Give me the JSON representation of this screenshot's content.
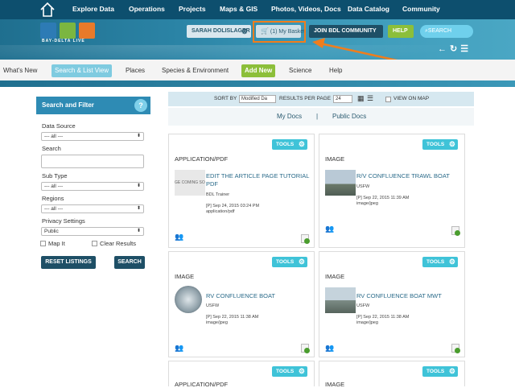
{
  "topnav": {
    "items": [
      "Explore Data",
      "Operations",
      "Projects",
      "Maps & GIS",
      "Photos, Videos, Docs",
      "Data Catalog",
      "Community"
    ]
  },
  "header": {
    "logo_text": "BAY-DELTA LIVE",
    "user_name": "SARAH DOLISLAGER",
    "basket_label": "(1) My Basket",
    "join_label": "JOIN BDL COMMUNITY",
    "help_label": "HELP",
    "search_placeholder": "SEARCH",
    "highlight_color": "#f07d1c"
  },
  "subnav": {
    "items": [
      "What's New",
      "Search & List View",
      "Places",
      "Species & Environment",
      "Add New",
      "Science",
      "Help"
    ],
    "active": "Search & List View"
  },
  "sidebar": {
    "title": "Search and Filter",
    "help_glyph": "?",
    "data_source_label": "Data Source",
    "data_source_value": "--- all ---",
    "search_label": "Search",
    "search_value": "",
    "subtype_label": "Sub Type",
    "subtype_value": "--- all ---",
    "regions_label": "Regions",
    "regions_value": "--- all ---",
    "privacy_label": "Privacy Settings",
    "privacy_value": "Public",
    "map_it_label": "Map It",
    "clear_results_label": "Clear Results",
    "reset_label": "RESET LISTINGS",
    "search_button_label": "SEARCH"
  },
  "sortbar": {
    "sort_by_label": "SORT BY",
    "sort_by_value": "Modified Da",
    "results_label": "RESULTS PER PAGE",
    "results_value": "24",
    "view_on_map_label": "VIEW ON MAP"
  },
  "docs_tabs": {
    "my_docs": "My Docs",
    "separator": "|",
    "public_docs": "Public Docs"
  },
  "cards": [
    {
      "tools": "TOOLS",
      "type": "APPLICATION/PDF",
      "title": "EDIT THE ARTICLE PAGE TUTORIAL PDF",
      "author": "BDL Trainer",
      "date": "[P] Sep 24, 2015 03:24 PM",
      "mime": "application/pdf",
      "thumb": "doc",
      "thumb_text": "GE COMING SO"
    },
    {
      "tools": "TOOLS",
      "type": "IMAGE",
      "title": "R/V CONFLUENCE TRAWL BOAT",
      "author": "USFW",
      "date": "[P] Sep 22, 2015 11:39 AM",
      "mime": "image/jpeg",
      "thumb": "boat"
    },
    {
      "tools": "TOOLS",
      "type": "IMAGE",
      "title": "RV CONFLUENCE BOAT",
      "author": "USFW",
      "date": "[P] Sep 22, 2015 11:38 AM",
      "mime": "image/jpeg",
      "thumb": "round"
    },
    {
      "tools": "TOOLS",
      "type": "IMAGE",
      "title": "RV CONFLUENCE BOAT MWT",
      "author": "USFW",
      "date": "[P] Sep 22, 2015 11:38 AM",
      "mime": "image/jpeg",
      "thumb": "boat2"
    },
    {
      "tools": "TOOLS",
      "type": "APPLICATION/PDF"
    },
    {
      "tools": "TOOLS",
      "type": "IMAGE"
    }
  ]
}
